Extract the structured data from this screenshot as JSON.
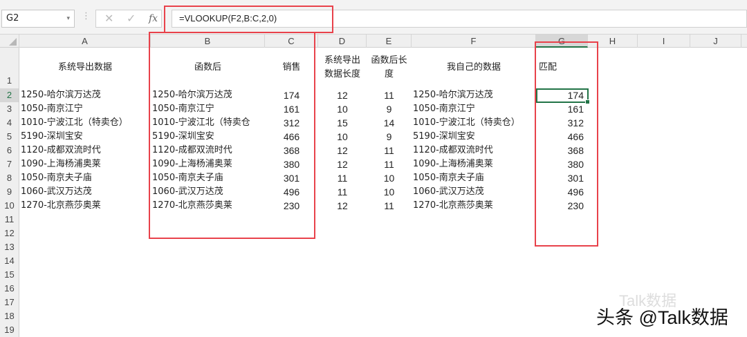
{
  "name_box": "G2",
  "formula_bar": {
    "fx_label": "fx",
    "cancel": "✕",
    "confirm": "✓",
    "formula": "=VLOOKUP(F2,B:C,2,0)"
  },
  "columns": [
    "A",
    "B",
    "C",
    "D",
    "E",
    "F",
    "G",
    "H",
    "I",
    "J"
  ],
  "header_row": {
    "A": "系统导出数据",
    "B": "函数后",
    "C": "销售",
    "D": "系统导出数据长度",
    "E": "函数后长度",
    "F": "我自己的数据",
    "G": "匹配"
  },
  "rows": [
    {
      "A": "1250-哈尔滨万达茂",
      "B": "1250-哈尔滨万达茂",
      "C": "174",
      "D": "12",
      "E": "11",
      "F": "1250-哈尔滨万达茂",
      "G": "174"
    },
    {
      "A": "1050-南京江宁",
      "B": "1050-南京江宁",
      "C": "161",
      "D": "10",
      "E": "9",
      "F": "1050-南京江宁",
      "G": "161"
    },
    {
      "A": "1010-宁波江北（特卖仓）",
      "B": "1010-宁波江北（特卖仓",
      "C": "312",
      "D": "15",
      "E": "14",
      "F": "1010-宁波江北（特卖仓）",
      "G": "312"
    },
    {
      "A": "5190-深圳宝安",
      "B": "5190-深圳宝安",
      "C": "466",
      "D": "10",
      "E": "9",
      "F": "5190-深圳宝安",
      "G": "466"
    },
    {
      "A": "1120-成都双流时代",
      "B": "1120-成都双流时代",
      "C": "368",
      "D": "12",
      "E": "11",
      "F": "1120-成都双流时代",
      "G": "368"
    },
    {
      "A": "1090-上海杨浦奥莱",
      "B": "1090-上海杨浦奥莱",
      "C": "380",
      "D": "12",
      "E": "11",
      "F": "1090-上海杨浦奥莱",
      "G": "380"
    },
    {
      "A": "1050-南京夫子庙",
      "B": "1050-南京夫子庙",
      "C": "301",
      "D": "11",
      "E": "10",
      "F": "1050-南京夫子庙",
      "G": "301"
    },
    {
      "A": "1060-武汉万达茂",
      "B": "1060-武汉万达茂",
      "C": "496",
      "D": "11",
      "E": "10",
      "F": "1060-武汉万达茂",
      "G": "496"
    },
    {
      "A": "1270-北京燕莎奥莱",
      "B": "1270-北京燕莎奥莱",
      "C": "230",
      "D": "12",
      "E": "11",
      "F": "1270-北京燕莎奥莱",
      "G": "230"
    }
  ],
  "row_numbers": [
    "1",
    "2",
    "3",
    "4",
    "5",
    "6",
    "7",
    "8",
    "9",
    "10",
    "11",
    "12",
    "13",
    "14",
    "15",
    "16",
    "17",
    "18",
    "19"
  ],
  "watermark": {
    "faint": "Talk数据",
    "main": "头条 @Talk数据"
  }
}
